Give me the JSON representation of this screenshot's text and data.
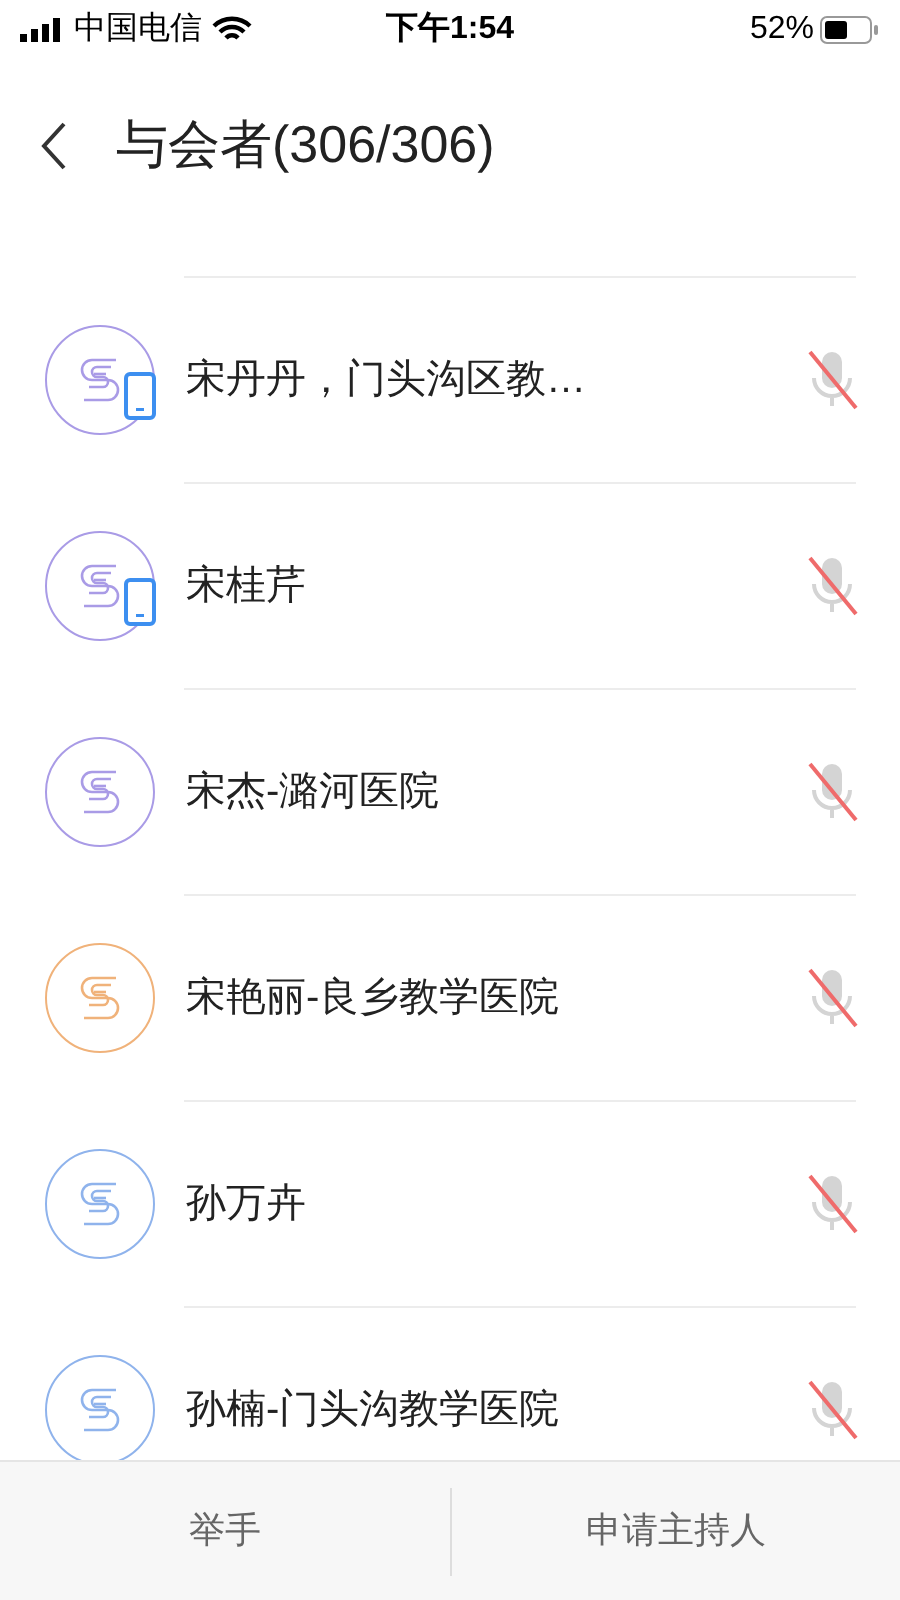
{
  "status_bar": {
    "carrier": "中国电信",
    "time": "下午1:54",
    "battery": "52%"
  },
  "header": {
    "title": "与会者(306/306)"
  },
  "participants": [
    {
      "name": "宋丹丹，门头沟区教…",
      "color": "#a99be6",
      "mobile": true,
      "muted": true
    },
    {
      "name": "宋桂芹",
      "color": "#a99be6",
      "mobile": true,
      "muted": true
    },
    {
      "name": "宋杰-潞河医院",
      "color": "#a99be6",
      "mobile": false,
      "muted": true
    },
    {
      "name": "宋艳丽-良乡教学医院",
      "color": "#f0b27a",
      "mobile": false,
      "muted": true
    },
    {
      "name": "孙万卉",
      "color": "#8fb3ec",
      "mobile": false,
      "muted": true
    },
    {
      "name": "孙楠-门头沟教学医院",
      "color": "#8fb3ec",
      "mobile": false,
      "muted": true
    }
  ],
  "bottom_bar": {
    "buttons": [
      "举手",
      "申请主持人"
    ]
  }
}
